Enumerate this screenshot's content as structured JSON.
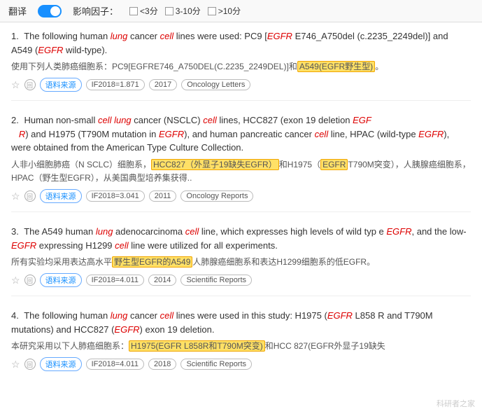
{
  "topbar": {
    "translate_label": "翻译",
    "filter_label": "影响因子：",
    "filter_options": [
      {
        "label": "<3分",
        "checked": false
      },
      {
        "label": "3-10分",
        "checked": false
      },
      {
        "label": ">10分",
        "checked": false
      }
    ]
  },
  "results": [
    {
      "num": "1.",
      "en": "The following human lung cancer cell lines were used: PC9 [EGFR E746_A750del (c.2235_2249del)] and A549 (EGFR wild-type).",
      "zh": "使用下列人类肺癌细胞系：PC9[EGFRE746_A750DEL(C.2235_2249DEL)]和A549(EGFR野生型)。",
      "highlight_zh": "A549(EGFR野生型)",
      "if_tag": "IF2018=1.871",
      "year_tag": "2017",
      "journal_tag": "Oncology Letters"
    },
    {
      "num": "2.",
      "en": "Human non-small cell lung cancer (NSCLC) cell lines, HCC827 (exon 19 deletion EGFR) and H1975 (T790M mutation in EGFR), and human pancreatic cancer cell line, HPAC (wild-type EGFR), were obtained from the American Type Culture Collection.",
      "zh": "人非小细胞肺癌（N SCLC）细胞系，HCC827（外显子19缺失EGFR）和H1975（EGFR T790M突变），人胰腺癌细胞系，HPAC（野生型EGFR），从美国典型培养集获得..",
      "highlight_zh1": "HCC827（外显子19缺失EGFR）",
      "highlight_zh2": "H1975（EGFR",
      "if_tag": "IF2018=3.041",
      "year_tag": "2011",
      "journal_tag": "Oncology Reports"
    },
    {
      "num": "3.",
      "en": "The A549 human lung adenocarcinoma cell line, which expresses high levels of wild type EGFR, and the low-EGFR expressing H1299 cell line were utilized for all experiments.",
      "zh": "所有实验均采用表达高水平野生型EGFR的A549人肺腺癌细胞系和表达H1299细胞系的低EGFR。",
      "highlight_zh": "野生型EGFR的A549",
      "if_tag": "IF2018=4.011",
      "year_tag": "2014",
      "journal_tag": "Scientific Reports"
    },
    {
      "num": "4.",
      "en": "The following human lung cancer cell lines were used in this study: H1975 (EGFR L858R and T790M mutations) and HCC827 (EGFR exon 19 deletion.",
      "zh": "本研究采用以下人肺癌细胞系：H1975(EGFR L858R和T790M突变)和HCC 827(EGFR外显子19缺失",
      "highlight_zh": "H1975(EGFR L858R和T790M突变)",
      "if_tag": "IF2018=4.011",
      "year_tag": "2018",
      "journal_tag": "Scientific Reports"
    }
  ],
  "watermark": "科研者之家"
}
